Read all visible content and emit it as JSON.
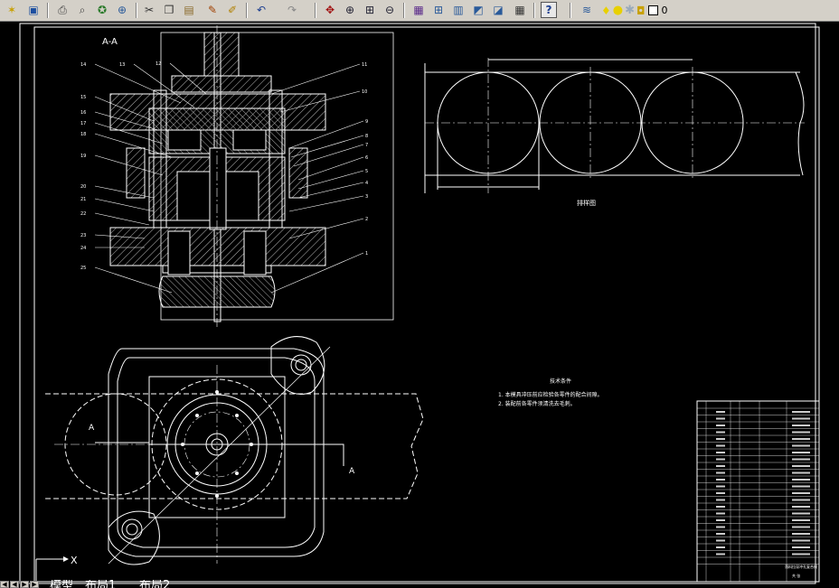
{
  "toolbar": {
    "buttons": [
      {
        "name": "new-file-icon",
        "glyph": "✶",
        "color": "#c8a000"
      },
      {
        "name": "save-icon",
        "glyph": "▣",
        "color": "#1d4fa0"
      },
      {
        "name": "print-icon",
        "glyph": "⎙",
        "color": "#444"
      },
      {
        "name": "print-preview-icon",
        "glyph": "⌕",
        "color": "#444"
      },
      {
        "name": "publish-icon",
        "glyph": "✪",
        "color": "#2a7a2a"
      },
      {
        "name": "plot-icon",
        "glyph": "⊕",
        "color": "#2a5a9a"
      },
      {
        "name": "cut-icon",
        "glyph": "✂",
        "color": "#333"
      },
      {
        "name": "copy-icon",
        "glyph": "❐",
        "color": "#333"
      },
      {
        "name": "paste-icon",
        "glyph": "▤",
        "color": "#8a6a2a"
      },
      {
        "name": "match-properties-icon",
        "glyph": "✎",
        "color": "#a04000"
      },
      {
        "name": "block-editor-icon",
        "glyph": "✐",
        "color": "#b08000"
      },
      {
        "name": "undo-icon",
        "glyph": "↶",
        "color": "#1d3f90"
      },
      {
        "name": "redo-icon",
        "glyph": "↷",
        "color": "#888"
      },
      {
        "name": "pan-icon",
        "glyph": "✥",
        "color": "#a01010"
      },
      {
        "name": "zoom-realtime-icon",
        "glyph": "⊕",
        "color": "#223"
      },
      {
        "name": "zoom-window-icon",
        "glyph": "⊞",
        "color": "#223"
      },
      {
        "name": "zoom-previous-icon",
        "glyph": "⊖",
        "color": "#223"
      },
      {
        "name": "properties-icon",
        "glyph": "▦",
        "color": "#5a2a8a"
      },
      {
        "name": "design-center-icon",
        "glyph": "⊞",
        "color": "#2a5a9a"
      },
      {
        "name": "tool-palettes-icon",
        "glyph": "▥",
        "color": "#2a5a9a"
      },
      {
        "name": "sheet-set-icon",
        "glyph": "◩",
        "color": "#2a5a9a"
      },
      {
        "name": "markup-icon",
        "glyph": "◪",
        "color": "#2a5a9a"
      },
      {
        "name": "calculator-icon",
        "glyph": "▦",
        "color": "#333"
      },
      {
        "name": "help-icon",
        "glyph": "?",
        "color": "#1d3f90"
      },
      {
        "name": "layer-manager-icon",
        "glyph": "≋",
        "color": "#2a5a9a"
      }
    ],
    "layer": {
      "name": "0",
      "icons": [
        "lightbulb-icon",
        "sun-icon",
        "freeze-icon",
        "lock-icon",
        "color-swatch-icon"
      ]
    }
  },
  "drawing": {
    "section_label": "A-A",
    "section_cut_label_left": "A",
    "section_cut_label_right": "A",
    "balloons_left": [
      "14",
      "13",
      "12",
      "15",
      "16",
      "17",
      "18",
      "19",
      "20",
      "21",
      "22",
      "23",
      "24",
      "25"
    ],
    "balloons_right": [
      "11",
      "10",
      "9",
      "8",
      "7",
      "6",
      "5",
      "4",
      "3",
      "2",
      "1"
    ],
    "strip_layout_label": "排样图",
    "tech_req_title": "技术条件",
    "tech_req_lines": [
      "1. 本模具冲压前应检验各零件的配合间隙。",
      "2. 装配前各零件须清洗去毛刺。"
    ],
    "title_block_text": "落料拉深冲孔复合模",
    "sheet_text": "共  张"
  },
  "layout_tabs": {
    "labels": [
      "模型",
      "布局1",
      "布局2"
    ]
  },
  "ucs": {
    "x_label": "X"
  }
}
